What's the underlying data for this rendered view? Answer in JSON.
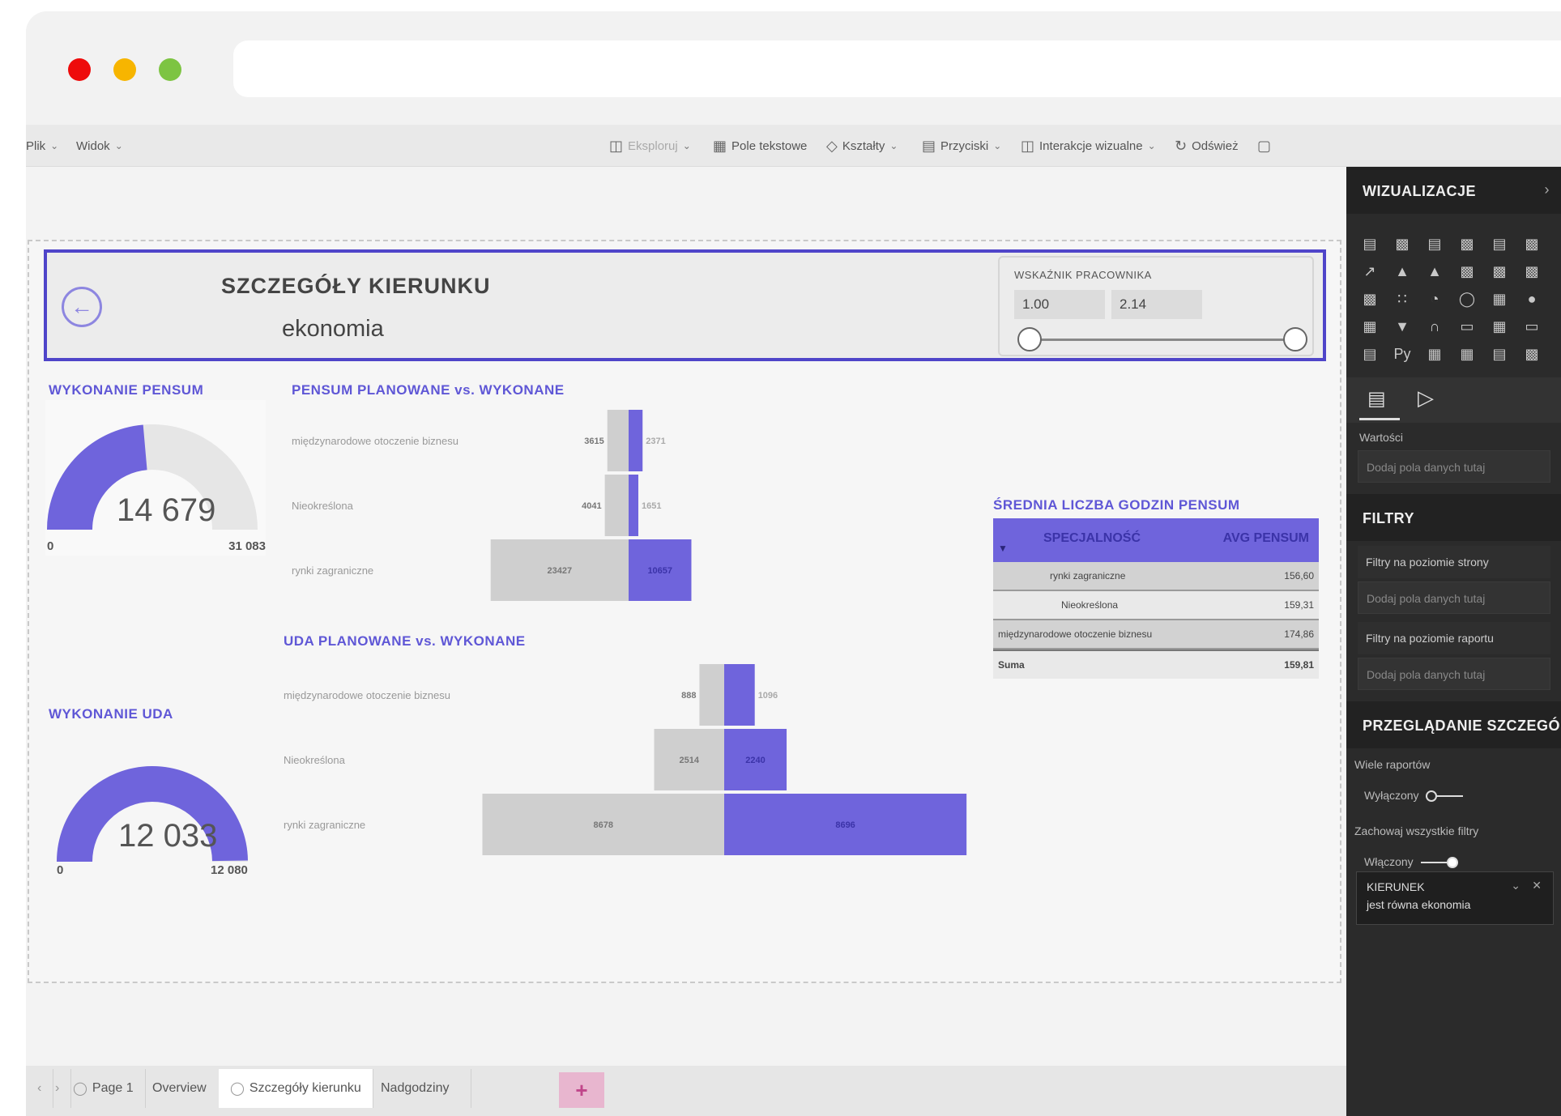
{
  "ribbon": {
    "file": "Plik",
    "view": "Widok",
    "explore": "Eksploruj",
    "textbox": "Pole tekstowe",
    "shapes": "Kształty",
    "buttons": "Przyciski",
    "interactions": "Interakcje wizualne",
    "refresh": "Odśwież"
  },
  "header": {
    "title": "SZCZEGÓŁY KIERUNKU",
    "subtitle": "ekonomia"
  },
  "slicer": {
    "title": "WSKAŹNIK PRACOWNIKA",
    "min": "1.00",
    "max": "2.14"
  },
  "gauge_pensum": {
    "title": "WYKONANIE PENSUM",
    "value_label": "14 679",
    "min": "0",
    "max": "31 083",
    "value": 14679,
    "max_value": 31083
  },
  "gauge_uda": {
    "title": "WYKONANIE UDA",
    "value_label": "12 033",
    "min": "0",
    "max": "12 080",
    "value": 12033,
    "max_value": 12080
  },
  "chart_data": [
    {
      "type": "bar",
      "title": "PENSUM PLANOWANE vs. WYKONANE",
      "categories": [
        "międzynarodowe otoczenie biznesu",
        "Nieokreślona",
        "rynki zagraniczne"
      ],
      "series": [
        {
          "values": [
            3615,
            4041,
            23427
          ]
        },
        {
          "values": [
            2371,
            1651,
            10657
          ]
        }
      ],
      "colors": [
        "#cfcfcf",
        "#6f64dc"
      ]
    },
    {
      "type": "bar",
      "title": "UDA PLANOWANE vs. WYKONANE",
      "categories": [
        "międzynarodowe otoczenie biznesu",
        "Nieokreślona",
        "rynki zagraniczne"
      ],
      "series": [
        {
          "values": [
            888,
            2514,
            8678
          ]
        },
        {
          "values": [
            1096,
            2240,
            8696
          ]
        }
      ],
      "colors": [
        "#cfcfcf",
        "#6f64dc"
      ]
    },
    {
      "type": "table",
      "title": "ŚREDNIA LICZBA GODZIN PENSUM",
      "columns": [
        "SPECJALNOŚĆ",
        "AVG PENSUM"
      ],
      "rows": [
        [
          "rynki zagraniczne",
          "156,60"
        ],
        [
          "Nieokreślona",
          "159,31"
        ],
        [
          "międzynarodowe otoczenie biznesu",
          "174,86"
        ]
      ],
      "total": [
        "Suma",
        "159,81"
      ]
    }
  ],
  "tabs": [
    "Page 1",
    "Overview",
    "Szczegóły kierunku",
    "Nadgodziny"
  ],
  "tab_add": "+",
  "panel": {
    "visualizations": "WIZUALIZACJE",
    "values_label": "Wartości",
    "add_fields": "Dodaj pola danych tutaj",
    "filters": "FILTRY",
    "page_filters": "Filtry na poziomie strony",
    "add_fields_2": "Dodaj pola danych tutaj",
    "report_filters": "Filtry na poziomie raportu",
    "add_fields_3": "Dodaj pola danych tutaj",
    "drillthrough": "PRZEGLĄDANIE SZCZEGÓ",
    "multi_reports": "Wiele raportów",
    "off": "Wyłączony",
    "keep_filters": "Zachowaj wszystkie filtry",
    "on": "Włączony",
    "filter_field": "KIERUNEK",
    "filter_value": "jest równa ekonomia"
  },
  "colors": {
    "accent": "#6f64dc",
    "planned": "#cfcfcf",
    "panel": "#2b2b2b"
  }
}
